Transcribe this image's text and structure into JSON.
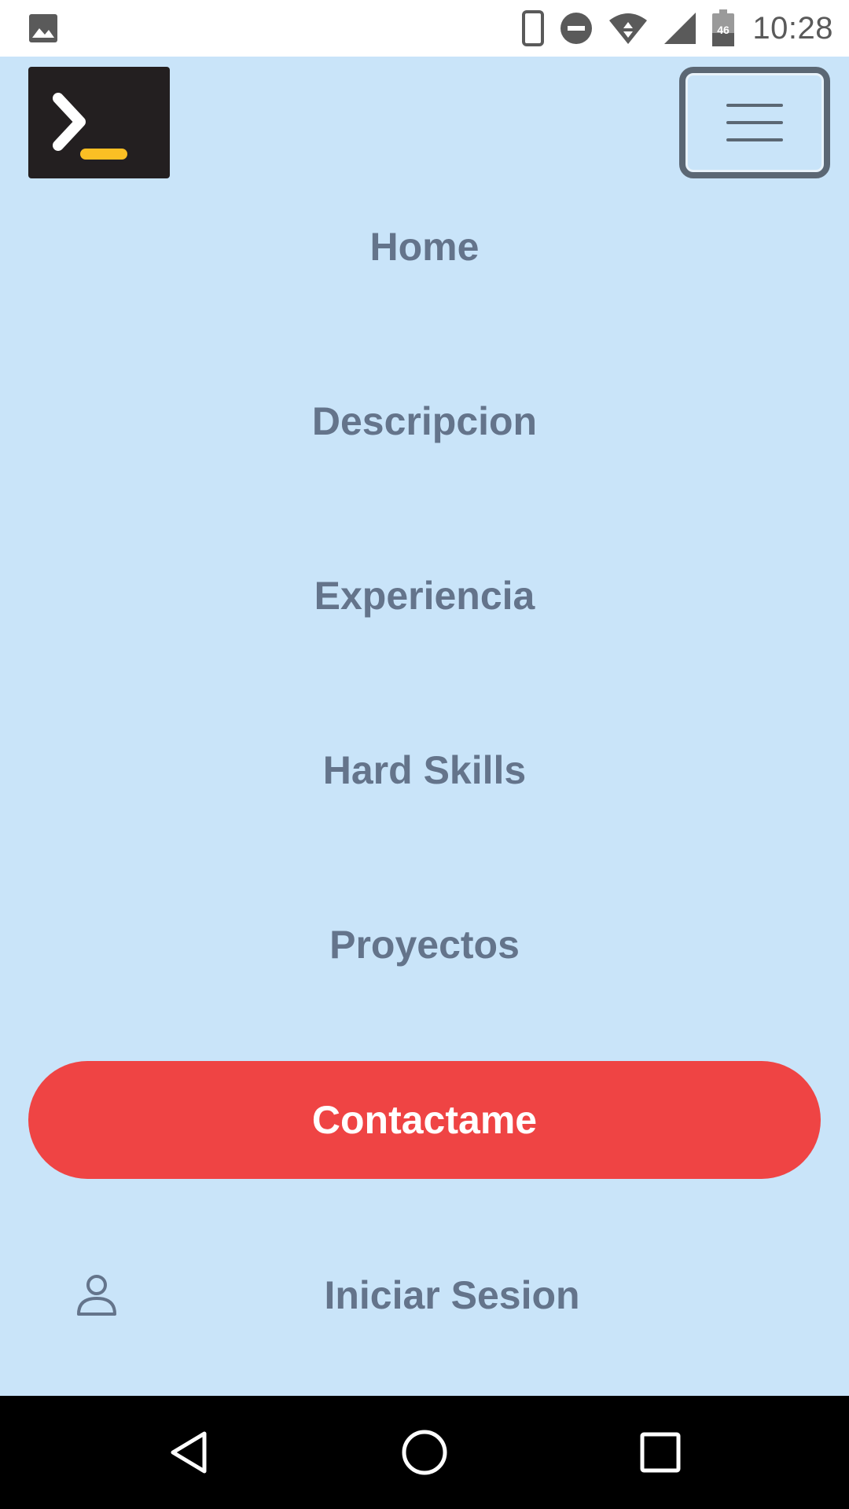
{
  "status_bar": {
    "time": "10:28",
    "battery_level": "46",
    "icons": [
      "image-icon",
      "phone-icon",
      "do-not-disturb-icon",
      "wifi-icon",
      "cell-signal-icon",
      "battery-icon"
    ]
  },
  "header": {
    "logo_icon": "terminal-icon",
    "menu_icon": "hamburger-icon"
  },
  "nav": {
    "items": [
      {
        "label": "Home"
      },
      {
        "label": "Descripcion"
      },
      {
        "label": "Experiencia"
      },
      {
        "label": "Hard Skills"
      },
      {
        "label": "Proyectos"
      }
    ]
  },
  "contact": {
    "label": "Contactame"
  },
  "login": {
    "icon": "user-icon",
    "label": "Iniciar Sesion"
  },
  "android_nav": {
    "icons": [
      "back-icon",
      "home-icon",
      "recents-icon"
    ]
  },
  "colors": {
    "background": "#c9e4f9",
    "nav_text": "#64748b",
    "contact_button": "#ef4444",
    "logo_bg": "#231f20",
    "logo_accent": "#fbbf24"
  }
}
